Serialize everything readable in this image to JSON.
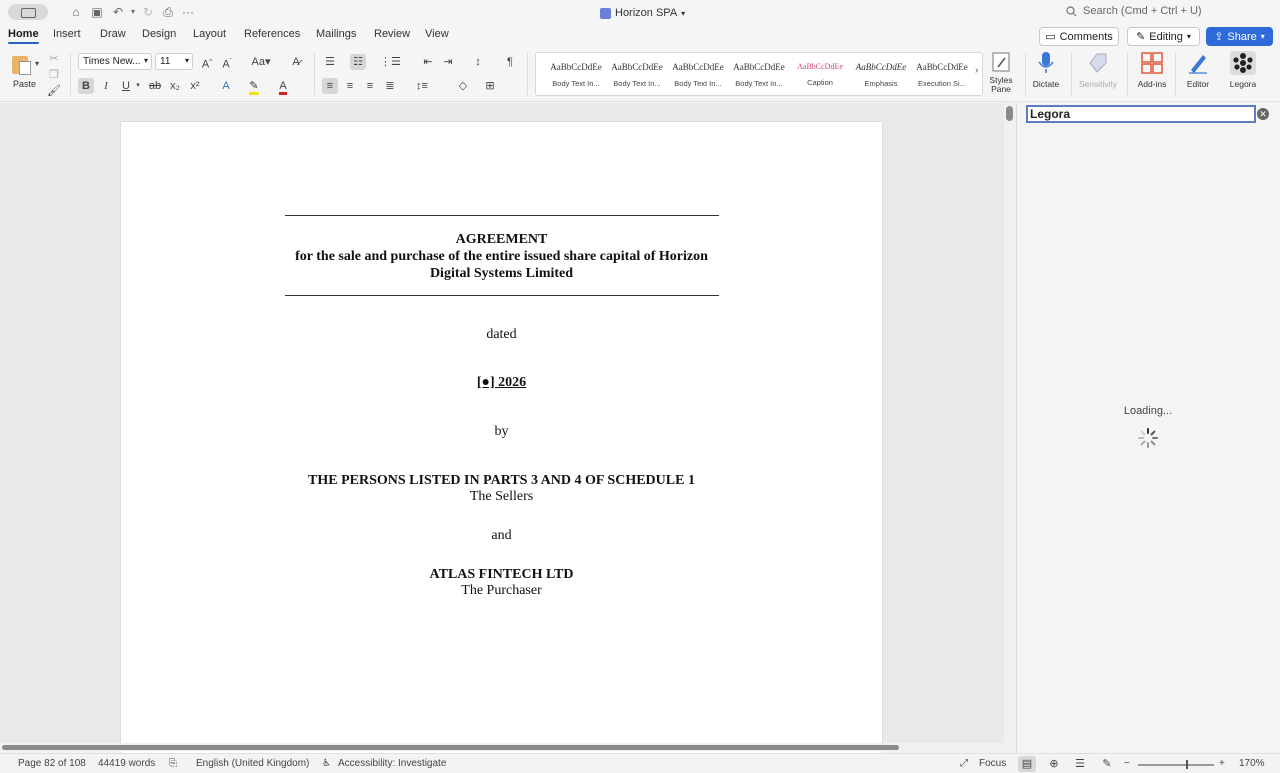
{
  "titlebar": {
    "doc_title": "Horizon SPA",
    "search_placeholder": "Search (Cmd + Ctrl + U)"
  },
  "tabs": [
    "Home",
    "Insert",
    "Draw",
    "Design",
    "Layout",
    "References",
    "Mailings",
    "Review",
    "View"
  ],
  "header_buttons": {
    "comments": "Comments",
    "editing": "Editing",
    "share": "Share"
  },
  "ribbon": {
    "paste": "Paste",
    "font_name": "Times New...",
    "font_size": "11",
    "styles": [
      {
        "sample": "AaBbCcDdEe",
        "name": "Body Text In..."
      },
      {
        "sample": "AaBbCcDdEe",
        "name": "Body Text In..."
      },
      {
        "sample": "AaBbCcDdEe",
        "name": "Body Text In..."
      },
      {
        "sample": "AaBbCcDdEe",
        "name": "Body Text In..."
      },
      {
        "sample": "AaBbCcDdEe",
        "name": "Caption"
      },
      {
        "sample": "AaBbCcDdEe",
        "name": "Emphasis"
      },
      {
        "sample": "AaBbCcDdEe",
        "name": "Execution Si..."
      }
    ],
    "styles_pane": "Styles Pane",
    "dictate": "Dictate",
    "sensitivity": "Sensitivity",
    "addins": "Add-ins",
    "editor": "Editor",
    "legora": "Legora"
  },
  "document": {
    "title": "AGREEMENT",
    "subtitle_line1": "for the sale and purchase of the entire issued share capital of Horizon",
    "subtitle_line2": "Digital Systems Limited",
    "dated": "dated",
    "date": "[●] 2026",
    "by": "by",
    "party1": "THE PERSONS LISTED IN PARTS 3 AND 4 OF SCHEDULE 1",
    "party1_role": "The Sellers",
    "and": "and",
    "party2": "ATLAS FINTECH LTD",
    "party2_role": "The Purchaser"
  },
  "side_panel": {
    "title": "Legora",
    "loading": "Loading..."
  },
  "status_bar": {
    "page": "Page 82 of 108",
    "words": "44419 words",
    "language": "English (United Kingdom)",
    "accessibility": "Accessibility: Investigate",
    "focus": "Focus",
    "zoom": "170%"
  }
}
